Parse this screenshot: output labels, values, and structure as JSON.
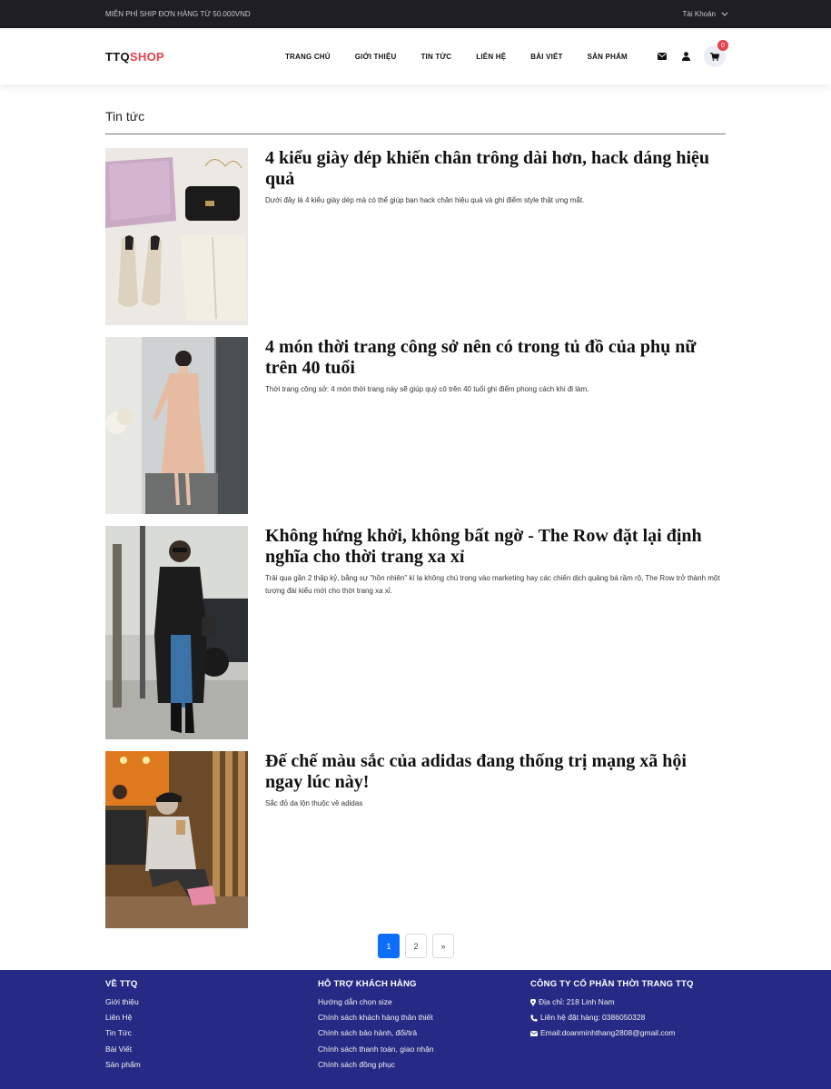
{
  "topbar": {
    "promo": "MIỄN PHÍ SHIP ĐƠN HÀNG TỪ 50.000VND",
    "account": "Tài Khoản"
  },
  "header": {
    "logo_part1": "TTQ",
    "logo_part2": "SHOP",
    "nav": [
      "TRANG CHỦ",
      "GIỚI THIỆU",
      "TIN TỨC",
      "LIÊN HỆ",
      "BÀI VIẾT",
      "SẢN PHẨM"
    ],
    "cart_count": "0",
    "icons": [
      "envelope-icon",
      "user-icon",
      "cart-icon"
    ]
  },
  "page_title": "Tin tức",
  "posts": [
    {
      "title": "4 kiểu giày dép khiến chân trông dài hơn, hack dáng hiệu quả",
      "excerpt": "Dưới đây là 4 kiểu giày dép mà có thể giúp bạn hack chân hiệu quả và ghi điểm style thật ưng mắt."
    },
    {
      "title": "4 món thời trang công sở nên có trong tủ đồ của phụ nữ trên 40 tuổi",
      "excerpt": "Thời trang công sở: 4 món thời trang này sẽ giúp quý cô trên 40 tuổi ghi điểm phong cách khi đi làm."
    },
    {
      "title": "Không hứng khởi, không bất ngờ - The Row đặt lại định nghĩa cho thời trang xa xỉ",
      "excerpt": "Trải qua gần 2 thập kỷ, bằng sự \"hồn nhiên\" kì lạ không chú trọng vào marketing hay các chiến dịch quảng bá rầm rộ, The Row trở thành một tượng đài kiểu mới cho thời trang xa xỉ."
    },
    {
      "title": "Đế chế màu sắc của adidas đang thống trị mạng xã hội ngay lúc này!",
      "excerpt": "Sắc đỏ da lộn thuộc về adidas"
    }
  ],
  "pagination": [
    "1",
    "2",
    "»"
  ],
  "footer": {
    "col1": {
      "title": "VỀ TTQ",
      "items": [
        "Giới thiệu",
        "Liên Hệ",
        "Tin Tức",
        "Bài Viết",
        "Sản phẩm"
      ]
    },
    "col2": {
      "title": "HỖ TRỢ KHÁCH HÀNG",
      "items": [
        "Hướng dẫn chọn size",
        "Chính sách khách hàng thân thiết",
        "Chính sách bảo hành, đổi/trả",
        "Chính sách thanh toán, giao nhận",
        "Chính sách đồng phục"
      ]
    },
    "col3": {
      "title": "CÔNG TY CỔ PHẦN THỜI TRANG TTQ",
      "items": [
        "Địa chỉ: 218 Linh Nam",
        "Liên hệ đặt hàng: 0386050328",
        "Email:doanminhthang2808@gmail.com"
      ]
    }
  },
  "colors": {
    "accent": "#e8414b",
    "footer_bg": "#272a85",
    "pager_active": "#0d6efd",
    "topbar_bg": "#1f1f23"
  }
}
